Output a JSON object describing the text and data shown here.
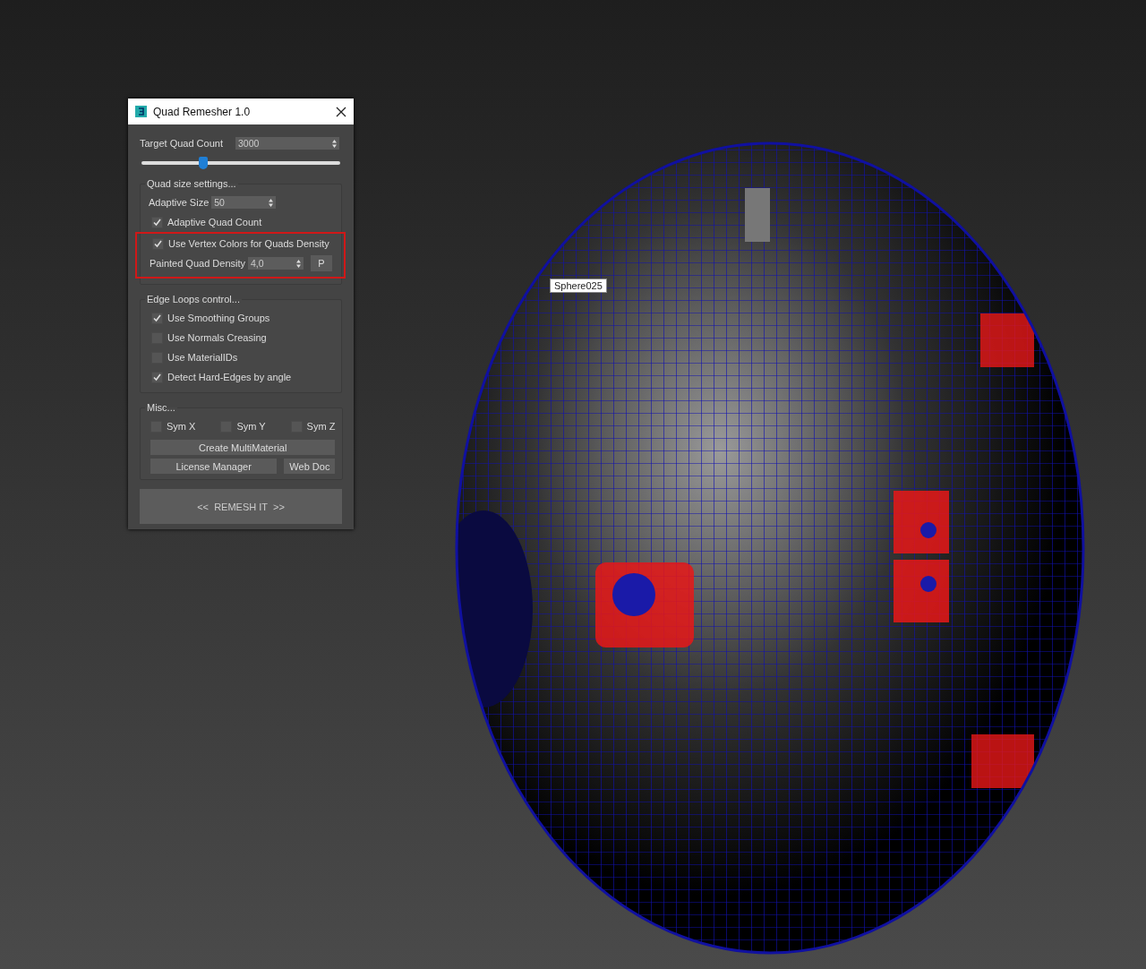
{
  "dialog": {
    "title": "Quad Remesher 1.0",
    "target_quad_count": {
      "label": "Target Quad Count",
      "value": "3000"
    },
    "slider": {
      "level": 0.31
    },
    "groups": [
      {
        "title": "Quad size settings...",
        "items": [
          {
            "kind": "spinner",
            "label": "Adaptive Size",
            "value": "50"
          },
          {
            "kind": "checkbox",
            "label": "Adaptive Quad Count",
            "checked": true
          },
          {
            "kind": "highlight",
            "items": [
              {
                "kind": "checkbox",
                "label": "Use Vertex Colors for Quads Density",
                "checked": true
              },
              {
                "kind": "spinner",
                "label": "Painted Quad Density",
                "value": "4,0",
                "button": "P"
              }
            ]
          }
        ]
      },
      {
        "title": "Edge Loops control...",
        "items": [
          {
            "kind": "checkbox",
            "label": "Use Smoothing Groups",
            "checked": true
          },
          {
            "kind": "checkbox",
            "label": "Use Normals Creasing",
            "checked": false
          },
          {
            "kind": "checkbox",
            "label": "Use MaterialIDs",
            "checked": false
          },
          {
            "kind": "checkbox",
            "label": "Detect Hard-Edges by angle",
            "checked": true
          }
        ]
      },
      {
        "title": "Misc...",
        "items": [
          {
            "kind": "checkrow",
            "checks": [
              {
                "label": "Sym X",
                "checked": false
              },
              {
                "label": "Sym Y",
                "checked": false
              },
              {
                "label": "Sym Z",
                "checked": false
              }
            ]
          },
          {
            "kind": "buttons",
            "buttons": [
              "Create MultiMaterial"
            ]
          },
          {
            "kind": "buttons",
            "buttons": [
              "License Manager",
              "Web Doc"
            ]
          }
        ]
      }
    ],
    "remesh_button": "<<  REMESH IT  >>"
  },
  "viewport": {
    "object_label": "Sphere025"
  }
}
